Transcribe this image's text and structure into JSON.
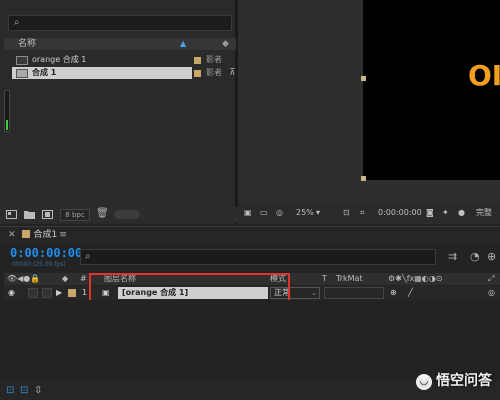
{
  "colors": {
    "accent": "#1e8ff0",
    "label_swatch": "#c9a76b",
    "canvas_text": "#f0a020",
    "highlight": "#e2342e",
    "selection": "#cfcfcf"
  },
  "project": {
    "search_placeholder": "",
    "column_header": "名称",
    "items": [
      {
        "name": "orange 合成 1",
        "type": "影者"
      },
      {
        "name": "合成 1",
        "type": "影者"
      }
    ],
    "bpc": "8 bpc"
  },
  "viewer": {
    "canvas_text": "OI",
    "zoom": "25%",
    "timecode": "0:00:00:00",
    "quality": "完整"
  },
  "timeline": {
    "tab_label": "合成1",
    "timecode": "0:00:00:00",
    "frames": "00000 (25.00 fps)",
    "columns": {
      "num": "#",
      "layer_name": "图层名称",
      "mode": "模式",
      "t": "T",
      "trkmat": "TrkMat"
    },
    "layer": {
      "index": "1",
      "name": "[orange 合成 1]",
      "mode": "正常"
    }
  },
  "watermark": "悟空问答"
}
